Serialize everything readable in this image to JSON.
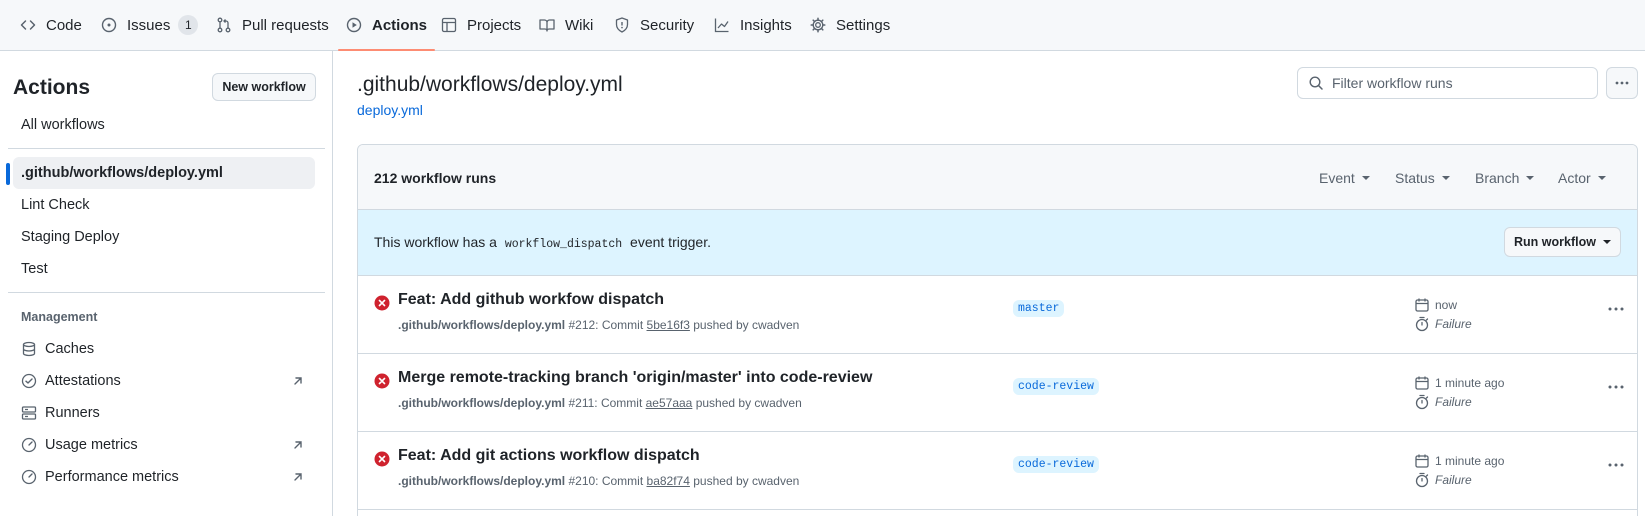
{
  "nav": {
    "tabs": [
      {
        "label": "Code",
        "icon": "code-icon"
      },
      {
        "label": "Issues",
        "icon": "issue-opened-icon",
        "count": "1"
      },
      {
        "label": "Pull requests",
        "icon": "git-pull-request-icon"
      },
      {
        "label": "Actions",
        "icon": "play-icon",
        "active": true
      },
      {
        "label": "Projects",
        "icon": "table-icon"
      },
      {
        "label": "Wiki",
        "icon": "book-icon"
      },
      {
        "label": "Security",
        "icon": "shield-icon"
      },
      {
        "label": "Insights",
        "icon": "graph-icon"
      },
      {
        "label": "Settings",
        "icon": "gear-icon"
      }
    ]
  },
  "sidebar": {
    "title": "Actions",
    "new_workflow_label": "New workflow",
    "all_workflows": "All workflows",
    "workflows": [
      {
        "label": ".github/workflows/deploy.yml",
        "selected": true
      },
      {
        "label": "Lint Check"
      },
      {
        "label": "Staging Deploy"
      },
      {
        "label": "Test"
      }
    ],
    "management_heading": "Management",
    "management": [
      {
        "label": "Caches",
        "icon": "database-icon",
        "external": false
      },
      {
        "label": "Attestations",
        "icon": "check-circle-icon",
        "external": true
      },
      {
        "label": "Runners",
        "icon": "server-icon",
        "external": false
      },
      {
        "label": "Usage metrics",
        "icon": "meter-icon",
        "external": true
      },
      {
        "label": "Performance metrics",
        "icon": "meter-icon",
        "external": true
      }
    ]
  },
  "main": {
    "title": ".github/workflows/deploy.yml",
    "file_link": "deploy.yml",
    "filter_placeholder": "Filter workflow runs",
    "runs_count": "212 workflow runs",
    "filters": [
      "Event",
      "Status",
      "Branch",
      "Actor"
    ],
    "dispatch": {
      "prefix": "This workflow has a",
      "code": "workflow_dispatch",
      "suffix": "event trigger."
    },
    "run_workflow_label": "Run workflow",
    "runs": [
      {
        "title": "Feat: Add github workfow dispatch",
        "workflow": ".github/workflows/deploy.yml",
        "number": "#212",
        "commit_prefix": ": Commit",
        "commit": "5be16f3",
        "pushed_by": "pushed by cwadven",
        "branch": "master",
        "time": "now",
        "status": "Failure"
      },
      {
        "title": "Merge remote-tracking branch 'origin/master' into code-review",
        "workflow": ".github/workflows/deploy.yml",
        "number": "#211",
        "commit_prefix": ": Commit",
        "commit": "ae57aaa",
        "pushed_by": "pushed by cwadven",
        "branch": "code-review",
        "time": "1 minute ago",
        "status": "Failure"
      },
      {
        "title": "Feat: Add git actions workflow dispatch",
        "workflow": ".github/workflows/deploy.yml",
        "number": "#210",
        "commit_prefix": ": Commit",
        "commit": "ba82f74",
        "pushed_by": "pushed by cwadven",
        "branch": "code-review",
        "time": "1 minute ago",
        "status": "Failure"
      }
    ]
  },
  "colors": {
    "accent": "#0969da",
    "failure": "#cf222e",
    "active_tab_underline": "#fd8c73",
    "dispatch_bg": "#ddf4ff"
  }
}
